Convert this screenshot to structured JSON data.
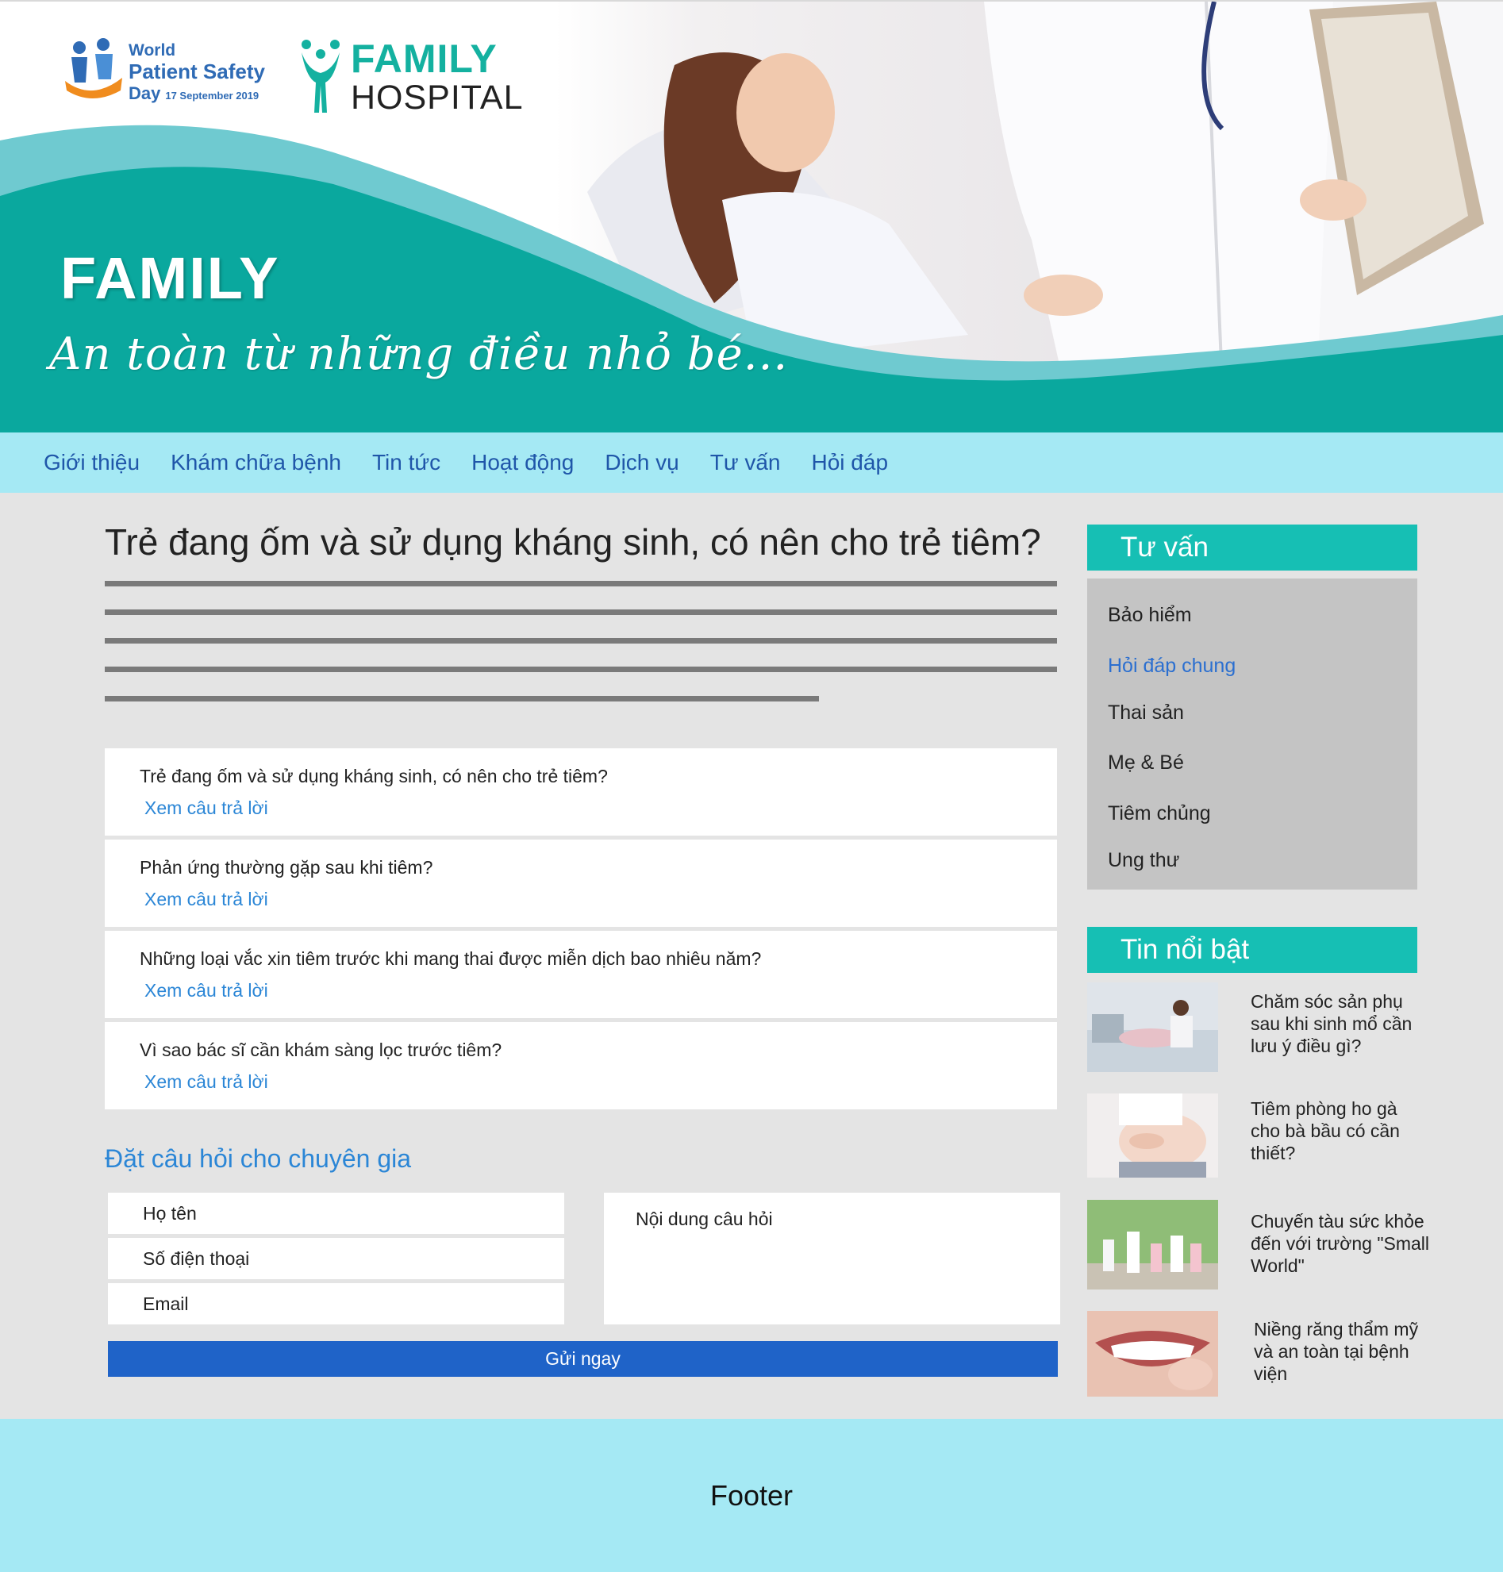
{
  "colors": {
    "brand_teal": "#14b1a0",
    "nav_bg": "#a5e9f4",
    "link_blue": "#2b86d6",
    "button_blue": "#1f63c8"
  },
  "header": {
    "wpsd_logo": {
      "line1": "World",
      "line2": "Patient Safety",
      "line3": "Day",
      "date": "17 September 2019"
    },
    "hospital_logo": {
      "word1": "FAMILY",
      "word2": "HOSPITAL"
    },
    "banner_title": "FAMILY",
    "banner_slogan": "An toàn từ những điều nhỏ bé..."
  },
  "nav": {
    "items": [
      {
        "label": "Giới thiệu"
      },
      {
        "label": "Khám chữa bệnh"
      },
      {
        "label": "Tin tức"
      },
      {
        "label": "Hoạt động"
      },
      {
        "label": "Dịch vụ"
      },
      {
        "label": "Tư vấn"
      },
      {
        "label": "Hỏi đáp"
      }
    ]
  },
  "article": {
    "title": "Trẻ đang ốm và sử dụng kháng sinh, có nên cho trẻ tiêm?"
  },
  "faq": {
    "items": [
      {
        "question": "Trẻ đang ốm và sử dụng kháng sinh, có nên cho trẻ tiêm?",
        "link": "Xem câu trả lời"
      },
      {
        "question": "Phản ứng thường gặp sau khi tiêm?",
        "link": "Xem câu trả lời"
      },
      {
        "question": "Những loại vắc xin tiêm trước khi mang thai được miễn dịch bao nhiêu năm?",
        "link": "Xem câu trả lời"
      },
      {
        "question": "Vì sao bác sĩ cần khám sàng lọc trước tiêm?",
        "link": "Xem câu trả lời"
      }
    ]
  },
  "ask_form": {
    "title": "Đặt câu hỏi cho chuyên gia",
    "name_placeholder": "Họ tên",
    "phone_placeholder": "Số điện thoại",
    "email_placeholder": "Email",
    "question_placeholder": "Nội dung câu hỏi",
    "submit_label": "Gửi ngay"
  },
  "sidebar": {
    "consult": {
      "title": "Tư vấn",
      "items": [
        {
          "label": "Bảo hiểm"
        },
        {
          "label": "Hỏi đáp chung"
        },
        {
          "label": "Thai sản"
        },
        {
          "label": "Mẹ & Bé"
        },
        {
          "label": "Tiêm chủng"
        },
        {
          "label": "Ung thư"
        }
      ]
    },
    "news": {
      "title": "Tin nổi bật",
      "items": [
        {
          "title": "Chăm sóc sản phụ sau khi sinh mổ cần lưu ý điều gì?"
        },
        {
          "title": "Tiêm phòng ho gà cho bà bầu có cần thiết?"
        },
        {
          "title": "Chuyến tàu sức khỏe đến với trường \"Small World\""
        },
        {
          "title": "Niềng răng thẩm mỹ và an toàn tại bệnh viện"
        }
      ]
    }
  },
  "footer": {
    "label": "Footer"
  }
}
